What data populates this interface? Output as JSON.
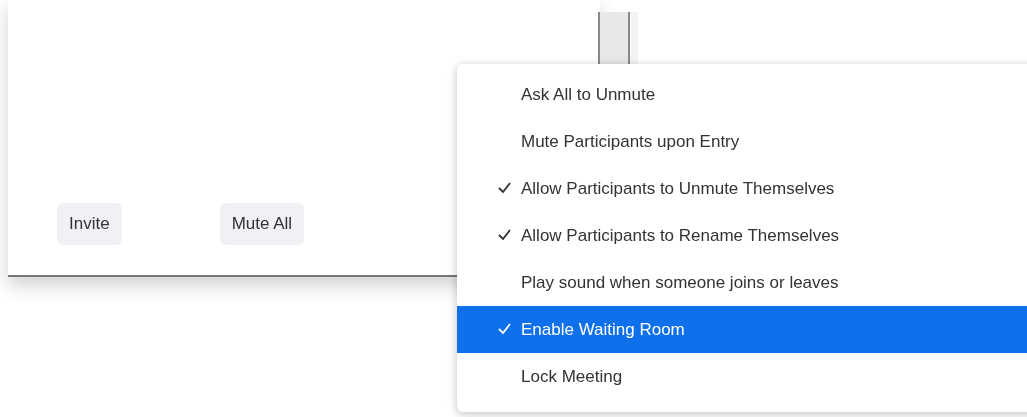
{
  "panel": {
    "buttons": [
      {
        "label": "Invite"
      },
      {
        "label": "Mute All"
      }
    ]
  },
  "menu": {
    "items": [
      {
        "label": "Ask All to Unmute",
        "checked": false,
        "selected": false
      },
      {
        "label": "Mute Participants upon Entry",
        "checked": false,
        "selected": false
      },
      {
        "label": "Allow Participants to Unmute Themselves",
        "checked": true,
        "selected": false
      },
      {
        "label": "Allow Participants to Rename Themselves",
        "checked": true,
        "selected": false
      },
      {
        "label": "Play sound when someone joins or leaves",
        "checked": false,
        "selected": false
      },
      {
        "label": "Enable Waiting Room",
        "checked": true,
        "selected": true
      },
      {
        "label": "Lock Meeting",
        "checked": false,
        "selected": false
      }
    ]
  }
}
